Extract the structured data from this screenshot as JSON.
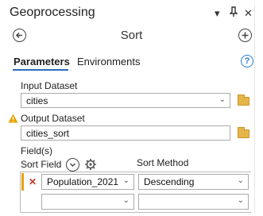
{
  "pane": {
    "title": "Geoprocessing",
    "controls": {
      "options": "▾",
      "pin": "⫯",
      "close": "✕"
    }
  },
  "tool": {
    "title": "Sort",
    "back_icon": "back-arrow-icon",
    "add_icon": "add-icon"
  },
  "tabs": [
    {
      "label": "Parameters",
      "active": true
    },
    {
      "label": "Environments",
      "active": false
    }
  ],
  "help": {
    "glyph": "?"
  },
  "params": {
    "input_dataset": {
      "label": "Input Dataset",
      "value": "cities"
    },
    "output_dataset": {
      "label": "Output Dataset",
      "value": "cities_sort",
      "warning": true
    },
    "fields": {
      "label": "Field(s)",
      "col_sort_field": "Sort Field",
      "col_sort_method": "Sort Method",
      "rows": [
        {
          "field": "Population_2021",
          "method": "Descending"
        },
        {
          "field": "",
          "method": ""
        }
      ]
    }
  },
  "colors": {
    "accent": "#2c6bbf",
    "warning": "#e8a200",
    "delete": "#c0392b"
  }
}
